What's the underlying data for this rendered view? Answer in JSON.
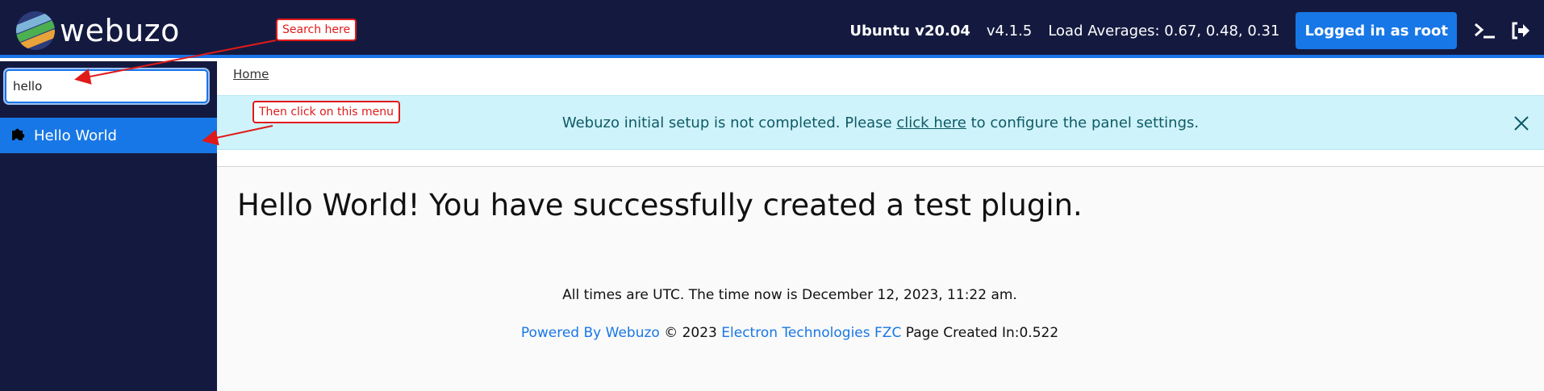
{
  "header": {
    "logo_text": "webuzo",
    "os": "Ubuntu v20.04",
    "version": "v4.1.5",
    "load_averages": "Load Averages: 0.67, 0.48, 0.31",
    "login_label": "Logged in as root",
    "terminal_icon": "terminal-icon",
    "logout_icon": "logout-icon"
  },
  "sidebar": {
    "search_value": "hello",
    "items": [
      {
        "label": "Hello World",
        "icon": "puzzle-icon"
      }
    ]
  },
  "main": {
    "breadcrumb": "Home",
    "alert": {
      "text_before": "Webuzo initial setup is not completed. Please ",
      "link": "click here",
      "text_after": " to configure the panel settings."
    },
    "heading": "Hello World! You have successfully created a test plugin.",
    "time_note": "All times are UTC. The time now is December 12, 2023, 11:22 am.",
    "footer": {
      "powered": "Powered By Webuzo",
      "copyright": "© 2023",
      "company": "Electron Technologies FZC",
      "page_created": "Page Created In:0.522"
    }
  },
  "annotations": {
    "search_callout": "Search here",
    "menu_callout": "Then click on this menu"
  },
  "colors": {
    "topbar": "#141a3f",
    "accent": "#1877e6",
    "alert_bg": "#cff3fa",
    "annotation": "#e01a1a"
  }
}
